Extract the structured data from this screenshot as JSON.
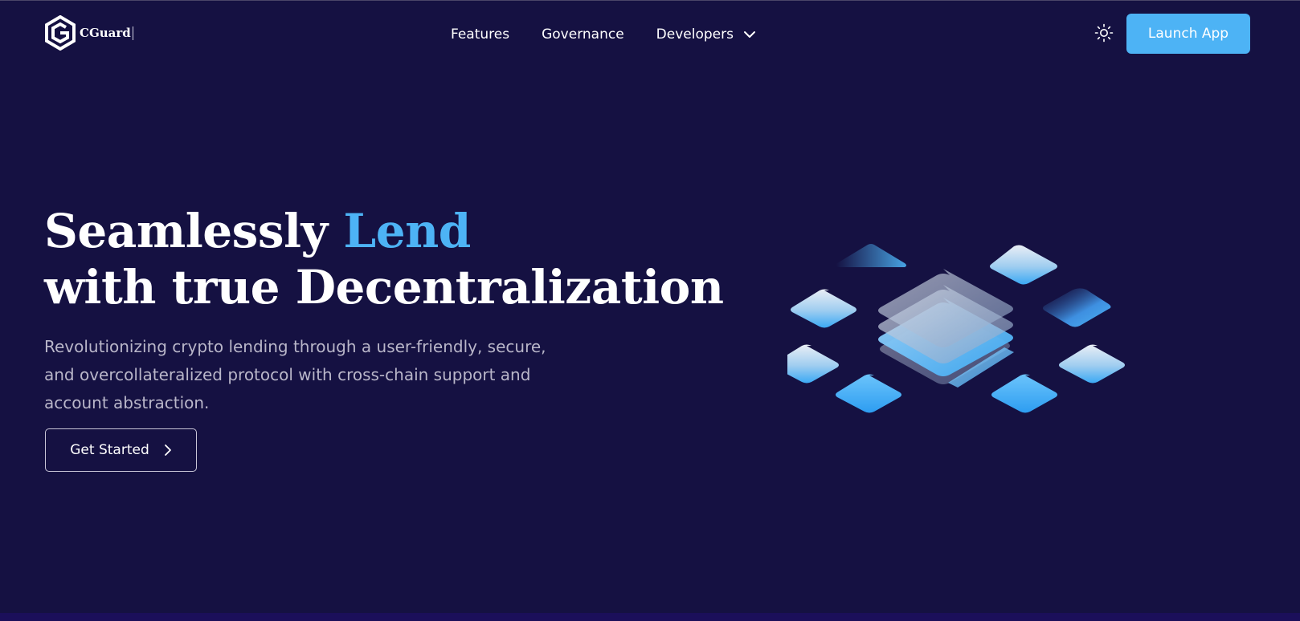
{
  "header": {
    "logo_text": "CGuard",
    "nav": [
      {
        "label": "Features"
      },
      {
        "label": "Governance"
      },
      {
        "label": "Developers"
      }
    ],
    "theme_toggle_icon": "sun-icon",
    "launch_label": "Launch App"
  },
  "hero": {
    "title_part1": "Seamlessly ",
    "title_accent": "Lend",
    "title_line2": "with true Decentralization",
    "subtitle": "Revolutionizing crypto lending through a user-friendly, secure, and overcollateralized protocol with cross-chain support and account abstraction.",
    "cta_label": "Get Started"
  },
  "colors": {
    "background": "#151142",
    "accent": "#4db3f5",
    "subtitle_text": "#b9b6c9"
  },
  "icons": {
    "logo": "cguard-logo-icon",
    "developers_chevron": "chevron-down-icon",
    "cta_chevron": "chevron-right-icon",
    "illustration": "isometric-blocks-illustration"
  }
}
